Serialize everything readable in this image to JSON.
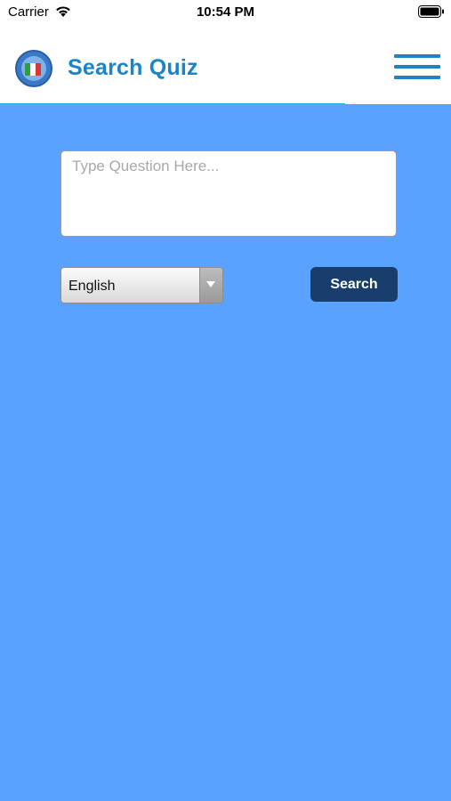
{
  "status_bar": {
    "carrier": "Carrier",
    "time": "10:54 PM",
    "icons": [
      "wifi-icon",
      "battery-icon"
    ]
  },
  "header": {
    "title": "Search Quiz",
    "logo": "app-logo",
    "menu_icon": "hamburger-menu-icon",
    "title_color": "#1a84c6",
    "accent_line_color": "#27b7e4"
  },
  "search_form": {
    "question_placeholder": "Type Question Here...",
    "question_value": "",
    "language_selected": "English",
    "search_label": "Search"
  },
  "colors": {
    "background": "#5aa2ff",
    "search_button": "#183e6e"
  }
}
